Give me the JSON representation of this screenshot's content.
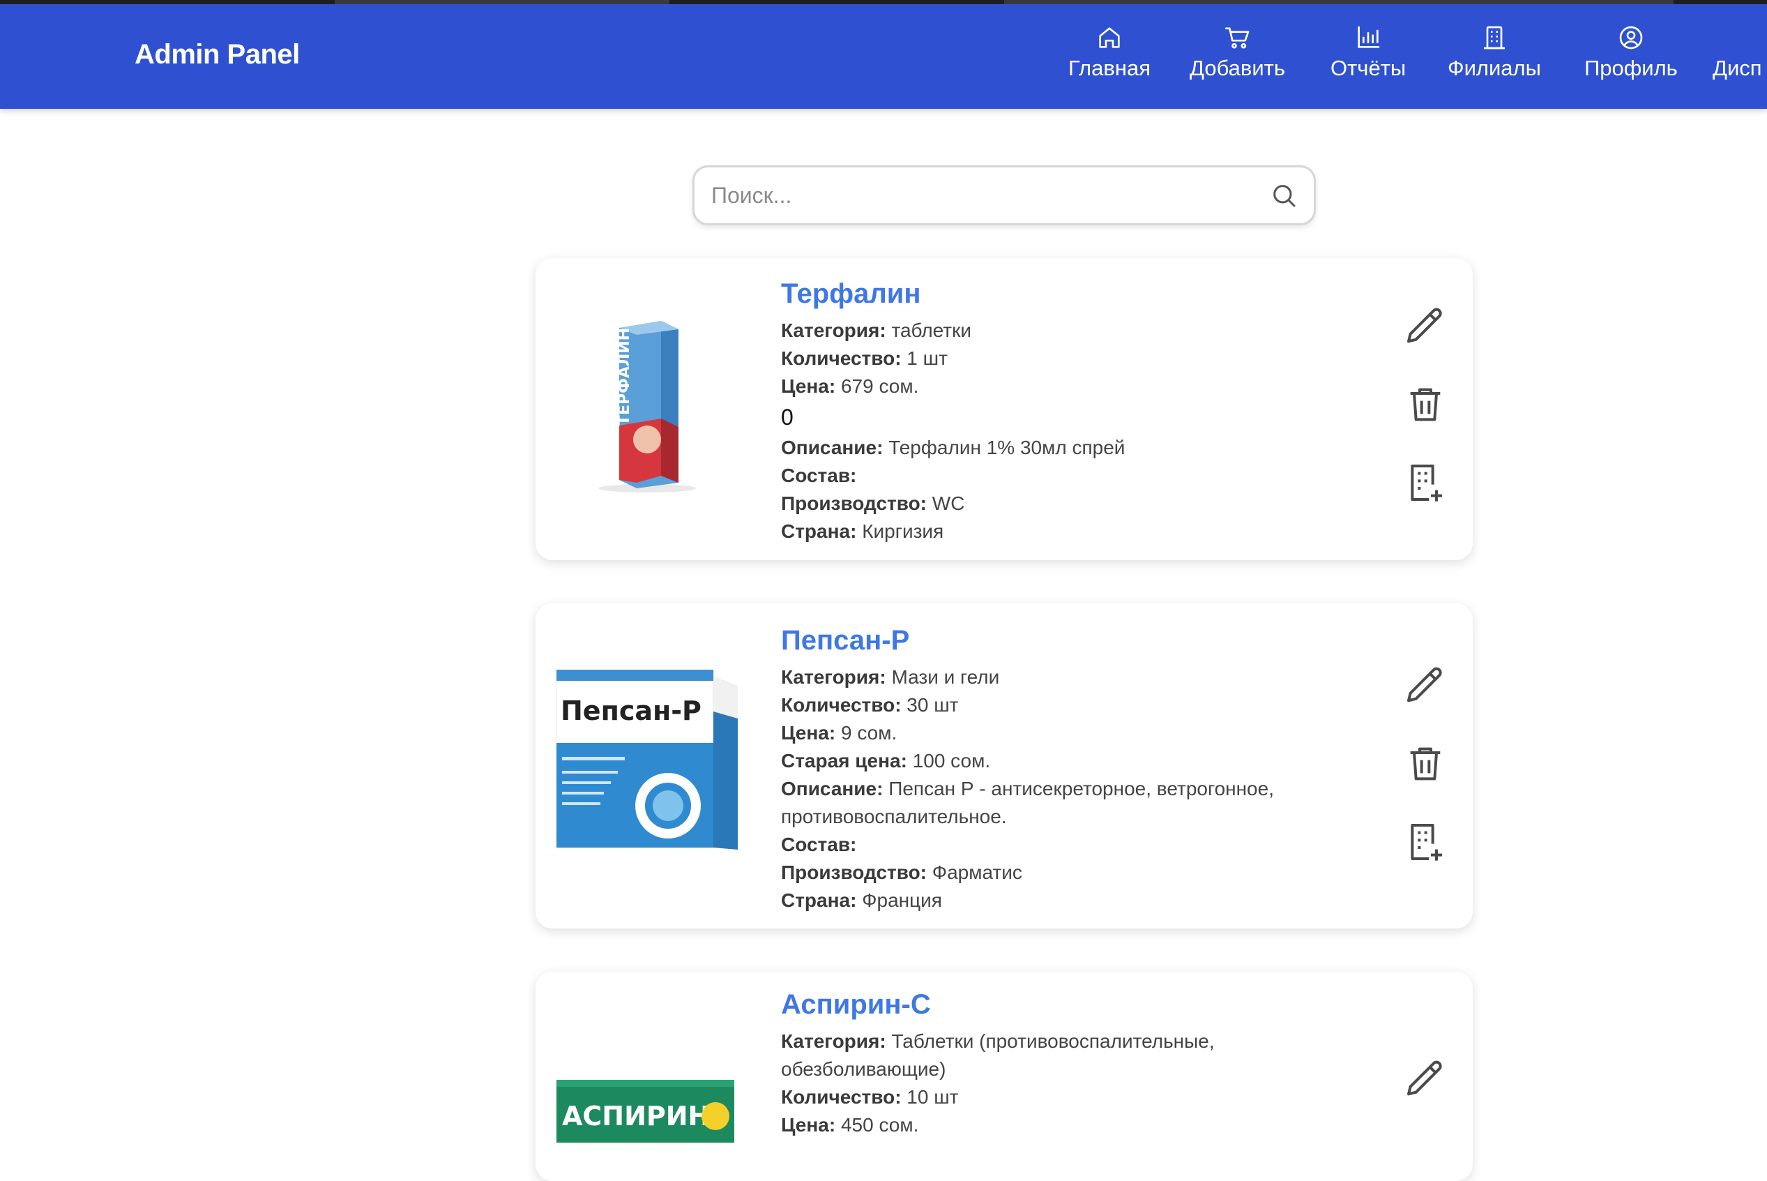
{
  "app": {
    "brand": "Admin Panel"
  },
  "nav": [
    {
      "label": "Главная",
      "icon": "home-icon"
    },
    {
      "label": "Добавить",
      "icon": "cart-icon"
    },
    {
      "label": "Отчёты",
      "icon": "chart-icon"
    },
    {
      "label": "Филиалы",
      "icon": "building-icon"
    },
    {
      "label": "Профиль",
      "icon": "user-circle-icon"
    },
    {
      "label": "Дисп",
      "icon": ""
    }
  ],
  "search": {
    "placeholder": "Поиск...",
    "value": ""
  },
  "labels": {
    "category": "Категория:",
    "quantity": "Количество:",
    "price": "Цена:",
    "old_price": "Старая цена:",
    "description": "Описание:",
    "composition": "Состав:",
    "manufacturer": "Производство:",
    "country": "Страна:"
  },
  "products": [
    {
      "name": "Терфалин",
      "category": "таблетки",
      "quantity": "1 шт",
      "price": "679 сом.",
      "extra": "0",
      "description": "Терфалин 1% 30мл спрей",
      "composition": "",
      "manufacturer": "WC",
      "country": "Киргизия",
      "image_text": "ТЕРФАЛИН"
    },
    {
      "name": "Пепсан-Р",
      "category": "Мази и гели",
      "quantity": "30 шт",
      "price": "9 сом.",
      "old_price": "100 сом.",
      "description_line1": "Пепсан Р - антисекреторное, ветрогонное,",
      "description_line2": "противовоспалительное.",
      "composition": "",
      "manufacturer": "Фарматис",
      "country": "Франция",
      "image_text": "Пепсан-Р"
    },
    {
      "name": "Аспирин-С",
      "category_line1": "Таблетки (противовоспалительные,",
      "category_line2": "обезболивающие)",
      "quantity": "10 шт",
      "price": "450 сом.",
      "image_text": "АСПИРИН"
    }
  ],
  "colors": {
    "navbar": "#2f51d1",
    "title": "#3f78e6"
  }
}
